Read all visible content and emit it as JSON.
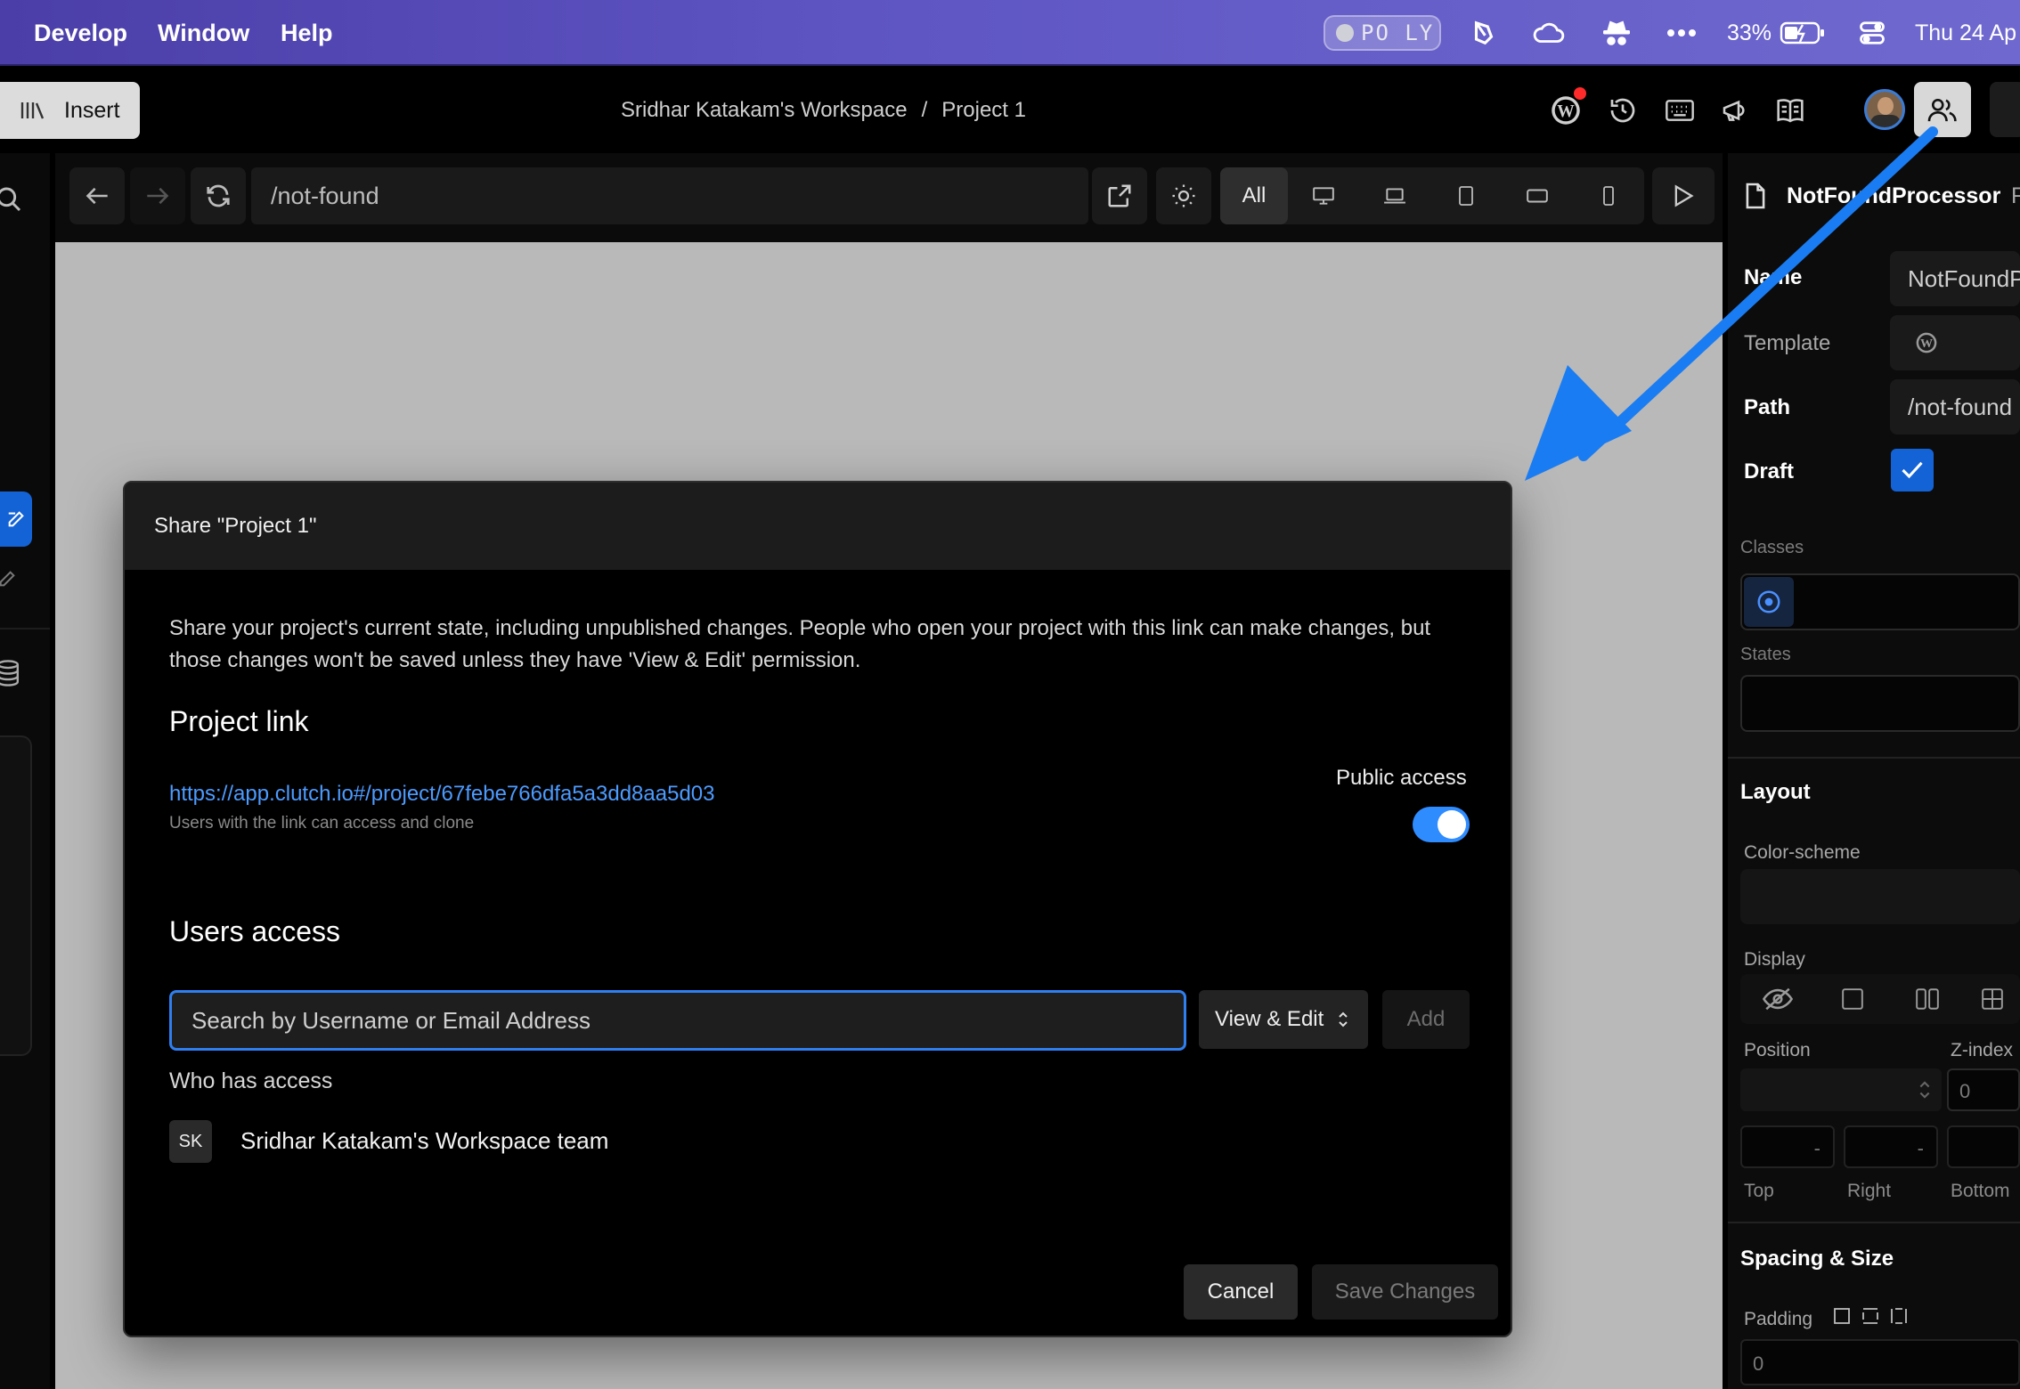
{
  "menubar": {
    "items": [
      "Develop",
      "Window",
      "Help"
    ],
    "recording_text": "PO LY",
    "battery": "33%",
    "datetime": "Thu 24 Ap"
  },
  "toolbar": {
    "insert_label": "Insert",
    "breadcrumb_workspace": "Sridhar Katakam's Workspace",
    "breadcrumb_sep": "/",
    "breadcrumb_project": "Project 1"
  },
  "urlbar": {
    "path": "/not-found",
    "viewport_all": "All"
  },
  "right_panel": {
    "component_title": "NotFoundProcessor",
    "component_title_suffix": "F",
    "name_label": "Name",
    "name_value": "NotFoundP",
    "template_label": "Template",
    "path_label": "Path",
    "path_value": "/not-found",
    "draft_label": "Draft",
    "draft_checked": true,
    "classes_label": "Classes",
    "states_label": "States",
    "layout_title": "Layout",
    "color_scheme_label": "Color-scheme",
    "display_label": "Display",
    "position_label": "Position",
    "zindex_label": "Z-index",
    "zindex_value": "0",
    "pos_placeholder": "-",
    "top_label": "Top",
    "right_label": "Right",
    "bottom_label": "Bottom",
    "spacing_title": "Spacing & Size",
    "padding_label": "Padding",
    "padding_value": "0"
  },
  "modal": {
    "title": "Share \"Project 1\"",
    "description": "Share your project's current state, including unpublished changes. People who open your project with this link can make changes, but those changes won't be saved unless they have 'View & Edit' permission.",
    "project_link_title": "Project link",
    "project_url": "https://app.clutch.io#/project/67febe766dfa5a3dd8aa5d03",
    "project_url_note": "Users with the link can access and clone",
    "public_access_label": "Public access",
    "public_access_on": true,
    "users_access_title": "Users access",
    "search_placeholder": "Search by Username or Email Address",
    "permission_value": "View & Edit",
    "add_label": "Add",
    "who_has_access_label": "Who has access",
    "members": [
      {
        "initials": "SK",
        "name": "Sridhar Katakam's Workspace team"
      }
    ],
    "cancel_label": "Cancel",
    "save_label": "Save Changes"
  },
  "colors": {
    "accent": "#1463d6",
    "link": "#4d9bff",
    "toggle": "#2f8cff",
    "annotation_arrow": "#1a7cf2"
  }
}
